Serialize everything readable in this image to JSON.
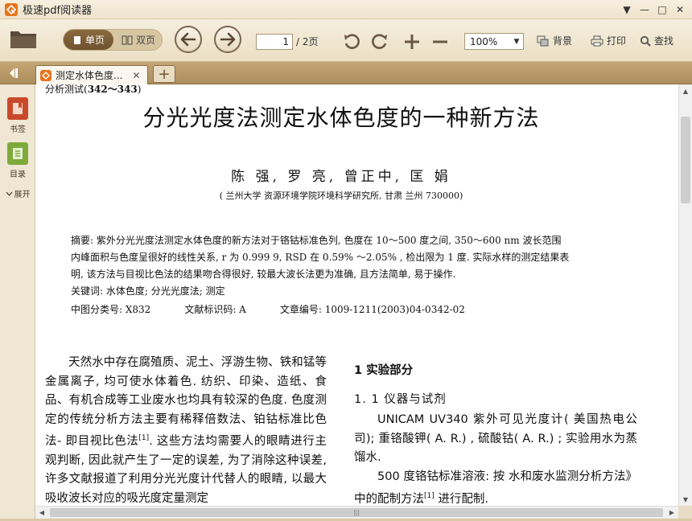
{
  "app": {
    "title": "极速pdf阅读器"
  },
  "window_controls": {
    "menu": "▼",
    "minimize": "—",
    "maximize": "□",
    "close": "✕"
  },
  "toolbar": {
    "single_page": "单页",
    "double_page": "双页",
    "current_page": "1",
    "page_total": "/ 2页",
    "zoom": "100%",
    "background": "背景",
    "print": "打印",
    "find": "查找"
  },
  "tabs": [
    {
      "label": "测定水体色度..."
    }
  ],
  "sidebar": {
    "bookmark": "书签",
    "toc": "目录",
    "expand": "展开"
  },
  "document": {
    "running_head_prefix": "分析测试(",
    "running_head_pages": "342～343",
    "running_head_suffix": ")",
    "title": "分光光度法测定水体色度的一种新方法",
    "authors": "陈 强, 罗 亮, 曾正中, 匡 娟",
    "affiliation": "( 兰州大学 资源环境学院环境科学研究所, 甘肃 兰州 730000)",
    "abstract_lines": [
      "摘要: 紫外分光光度法测定水体色度的新方法对于铬钴标准色列, 色度在 10～500 度之间, 350～600 nm 波长范围",
      "内峰面积与色度呈很好的线性关系, r 为 0.999 9, RSD 在 0.59% ～2.05% , 检出限为 1 度. 实际水样的测定结果表",
      "明, 该方法与目视比色法的结果吻合得很好, 较最大波长法更为准确, 且方法简单, 易于操作.",
      "关键词: 水体色度; 分光光度法; 测定"
    ],
    "clc": "中图分类号: X832",
    "doc_code": "文献标识码: A",
    "article_no": "文章编号: 1009-1211(2003)04-0342-02",
    "left_col_before_ref": "天然水中存在腐殖质、泥土、浮游生物、铁和锰等金属离子, 均可使水体着色. 纺织、印染、造纸、食品、有机合成等工业废水也均具有较深的色度. 色度测定的传统分析方法主要有稀释倍数法、铂钴标准比色法- 即目视比色法",
    "left_ref": "[1]",
    "left_col_after_ref": ". 这些方法均需要人的眼睛进行主观判断, 因此就产生了一定的误差, 为了消除这种误差, 许多文献报道了利用分光光度计代替人的眼睛, 以最大吸收波长对应的吸光度定量测定",
    "section_title": "1   实验部分",
    "subsection_title": "1. 1   仪器与试剂",
    "right_p1": "UNICAM UV340 紫外可见光度计( 美国热电公司); 重铬酸钾( A. R.) , 硫酸钴( A. R.) ; 实验用水为蒸馏水.",
    "right_p2_before_ref": "500 度铬钴标准溶液: 按 水和废水监测分析方法》中的配制方法",
    "right_ref": "[1]",
    "right_p2_after_ref": " 进行配制."
  },
  "scrollbar": {
    "h_grip": "|||"
  },
  "colors": {
    "accent": "#e8731a",
    "toolbar_bg": "#efe4cc",
    "tabbar_bg": "#b89a68",
    "sidebar_bg": "#efe6d3"
  }
}
